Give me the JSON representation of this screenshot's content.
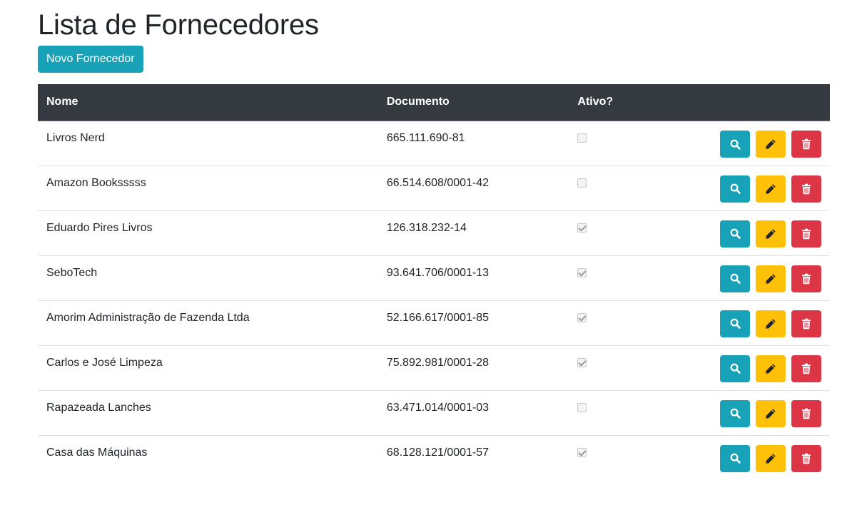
{
  "page": {
    "title": "Lista de Fornecedores",
    "new_button_label": "Novo Fornecedor"
  },
  "table": {
    "headers": {
      "nome": "Nome",
      "documento": "Documento",
      "ativo": "Ativo?"
    },
    "rows": [
      {
        "nome": "Livros Nerd",
        "documento": "665.111.690-81",
        "ativo": false
      },
      {
        "nome": "Amazon Booksssss",
        "documento": "66.514.608/0001-42",
        "ativo": false
      },
      {
        "nome": "Eduardo Pires Livros",
        "documento": "126.318.232-14",
        "ativo": true
      },
      {
        "nome": "SeboTech",
        "documento": "93.641.706/0001-13",
        "ativo": true
      },
      {
        "nome": "Amorim Administração de Fazenda Ltda",
        "documento": "52.166.617/0001-85",
        "ativo": true
      },
      {
        "nome": "Carlos e José Limpeza",
        "documento": "75.892.981/0001-28",
        "ativo": true
      },
      {
        "nome": "Rapazeada Lanches",
        "documento": "63.471.014/0001-03",
        "ativo": false
      },
      {
        "nome": "Casa das Máquinas",
        "documento": "68.128.121/0001-57",
        "ativo": true
      }
    ],
    "row_actions": [
      "search-icon",
      "pencil-icon",
      "trash-icon"
    ]
  },
  "colors": {
    "info": "#17a2b8",
    "warning": "#ffc107",
    "danger": "#dc3545",
    "header_dark": "#343a40"
  }
}
